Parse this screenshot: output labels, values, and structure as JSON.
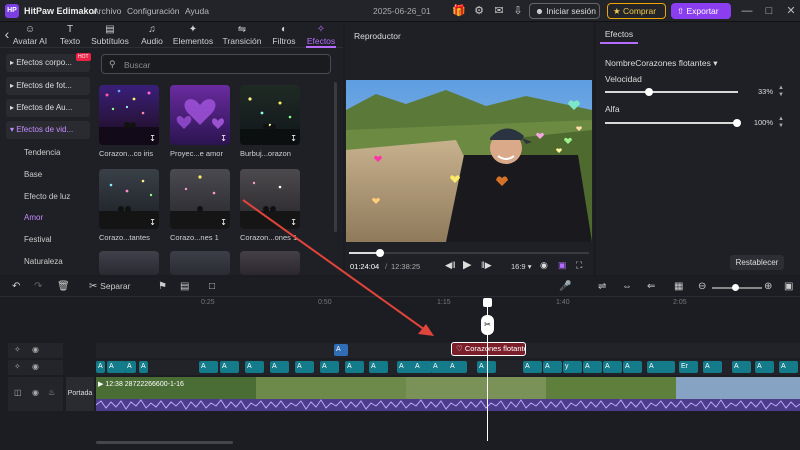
{
  "titlebar": {
    "app_name": "HitPaw Edimakor",
    "menu": [
      "Archivo",
      "Configuración",
      "Ayuda"
    ],
    "project_name": "2025-06-26_01",
    "login": "Iniciar sesión",
    "buy": "Comprar",
    "export": "Exportar"
  },
  "toolbar_tabs": [
    {
      "label": "Avatar AI",
      "icon": "avatar-icon"
    },
    {
      "label": "Texto",
      "icon": "text-icon"
    },
    {
      "label": "Subtítulos",
      "icon": "subtitles-icon"
    },
    {
      "label": "Audio",
      "icon": "music-icon"
    },
    {
      "label": "Elementos",
      "icon": "elements-icon"
    },
    {
      "label": "Transición",
      "icon": "transition-icon"
    },
    {
      "label": "Filtros",
      "icon": "filter-icon"
    },
    {
      "label": "Efectos",
      "icon": "effects-icon",
      "active": true
    }
  ],
  "sidebar": {
    "categories": [
      "Efectos corpo...",
      "Efectos de fot...",
      "Efectos de Au...",
      "Efectos de vid..."
    ],
    "hot_badge": "HOT",
    "subitems": [
      "Tendencia",
      "Base",
      "Efecto de luz",
      "Amor",
      "Festival",
      "Naturaleza"
    ],
    "active_subitem": "Amor"
  },
  "search": {
    "placeholder": "Buscar"
  },
  "effects_grid": [
    {
      "label": "Corazon...co iris"
    },
    {
      "label": "Proyec...e amor"
    },
    {
      "label": "Burbuj...orazon"
    },
    {
      "label": "Corazo...tantes"
    },
    {
      "label": "Corazo...nes 1"
    },
    {
      "label": "Corazon...ones 1"
    }
  ],
  "player": {
    "title": "Reproductor",
    "current_time": "01:24:04",
    "total_time": "12:38:25",
    "ratio": "16:9",
    "progress": 0.12
  },
  "effects_panel": {
    "tab": "Efectos",
    "effect_name": "NombreCorazones flotantes",
    "speed_label": "Velocidad",
    "speed_value": "33%",
    "speed_level": 0.33,
    "alpha_label": "Alfa",
    "alpha_value": "100%",
    "alpha_level": 1.0,
    "reset": "Restablecer"
  },
  "timeline": {
    "split_label": "Separar",
    "ruler_marks": [
      "0:25",
      "0:50",
      "1:15",
      "1:40",
      "2:05"
    ],
    "effect_clip": "Corazones flotantes",
    "video_clip": "12:38 28722266600-1-16",
    "cover_label": "Portada",
    "text_clip_label": "A",
    "text_clips_extra": [
      "Er",
      "y"
    ]
  },
  "colors": {
    "accent": "#b56cff",
    "export": "#8b3df0",
    "buy": "#f0a400",
    "text_clip": "#147b8a",
    "effect_clip": "#7a1f2a",
    "annotation_arrow": "#e0443a"
  }
}
